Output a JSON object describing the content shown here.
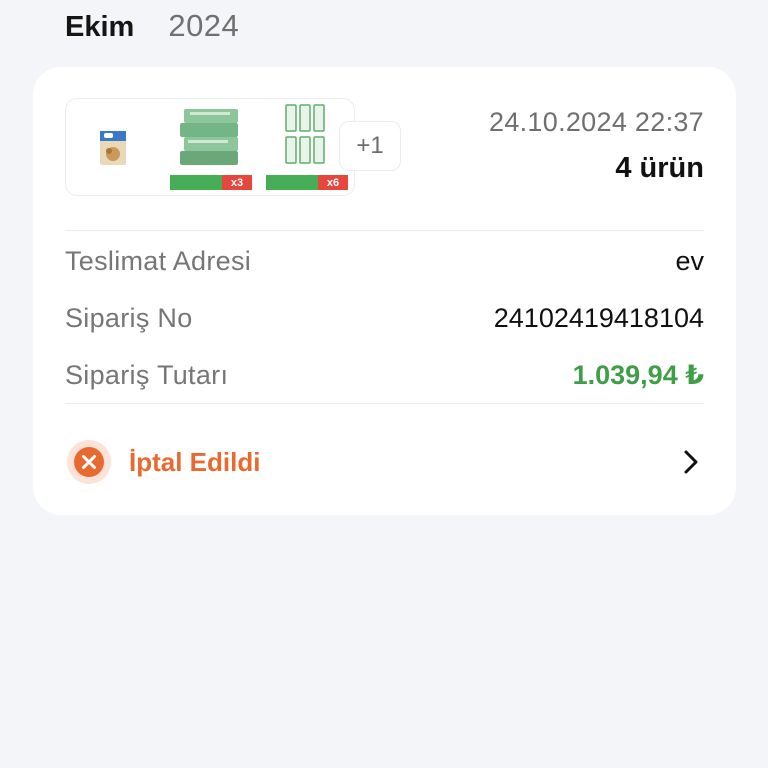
{
  "header": {
    "month": "Ekim",
    "year": "2024"
  },
  "order": {
    "datetime": "24.10.2024 22:37",
    "item_count": "4 ürün",
    "products": [
      {
        "name": "cereal-box-icon"
      },
      {
        "name": "butter-pack-icon",
        "qty": "x3"
      },
      {
        "name": "milk-cartons-icon",
        "qty": "x6"
      }
    ],
    "more_items": "+1",
    "details": [
      {
        "label": "Teslimat Adresi",
        "value": "ev"
      },
      {
        "label": "Sipariş No",
        "value": "24102419418104"
      },
      {
        "label": "Sipariş Tutarı",
        "value": "1.039,94 ₺"
      }
    ],
    "status": "İptal Edildi",
    "colors": {
      "status": "#e96a30",
      "total": "#3f9e48"
    }
  }
}
